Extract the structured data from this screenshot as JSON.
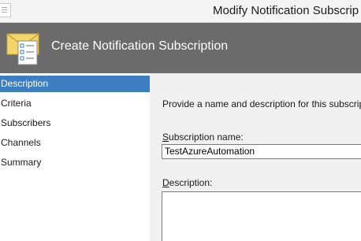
{
  "window": {
    "title": "Modify Notification Subscrip"
  },
  "banner": {
    "title": "Create Notification Subscription",
    "icon": "envelope-checklist-icon"
  },
  "nav": {
    "items": [
      {
        "label": "Description",
        "selected": true
      },
      {
        "label": "Criteria",
        "selected": false
      },
      {
        "label": "Subscribers",
        "selected": false
      },
      {
        "label": "Channels",
        "selected": false
      },
      {
        "label": "Summary",
        "selected": false
      }
    ]
  },
  "form": {
    "intro": "Provide a name and description for this subscriptio",
    "name_label_accel": "S",
    "name_label_rest": "ubscription name:",
    "name_value": "TestAzureAutomation",
    "desc_label_accel": "D",
    "desc_label_rest": "escription:",
    "desc_value": ""
  },
  "colors": {
    "banner_bg": "#6b6b6b",
    "nav_selected": "#3d7ec2",
    "content_bg": "#f0f0f0"
  }
}
